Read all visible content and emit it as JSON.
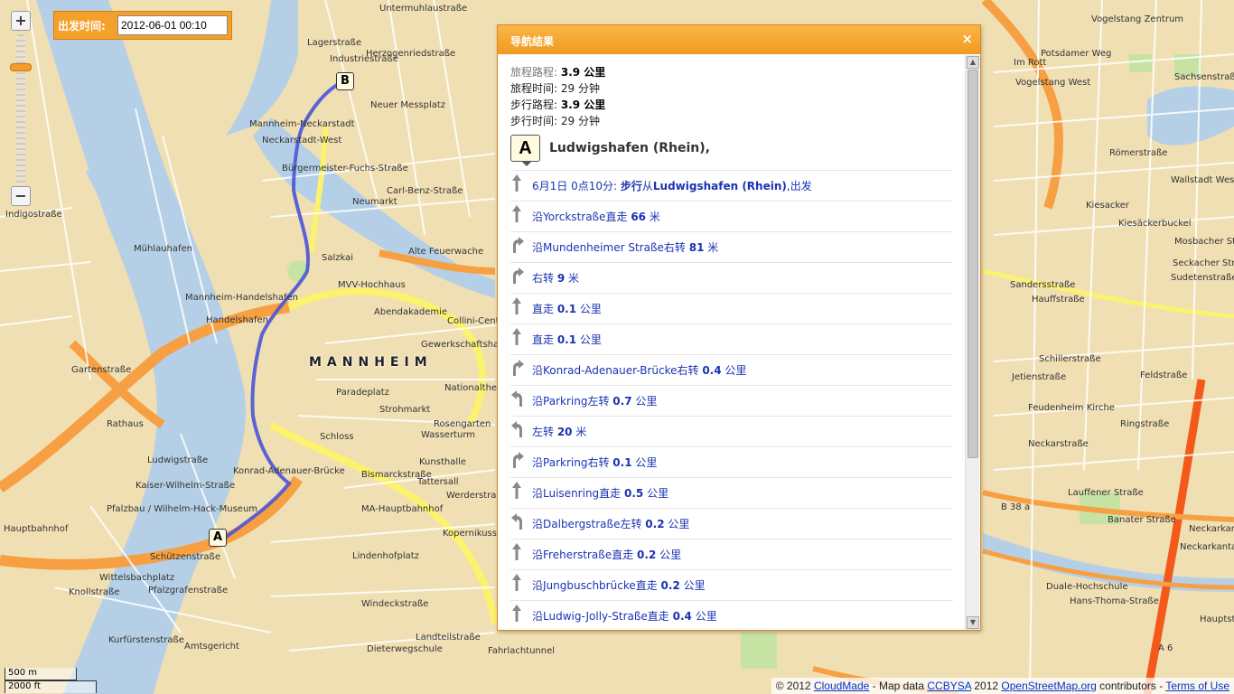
{
  "departure": {
    "label": "出发时间:",
    "value": "2012-06-01 00:10"
  },
  "zoom": {
    "in_label": "+",
    "out_label": "−"
  },
  "scale": {
    "metric": "500 m",
    "imperial": "2000 ft"
  },
  "attribution": {
    "prefix": "© 2012 ",
    "cloudmade": "CloudMade",
    "mapdata": " - Map data ",
    "ccbysa": "CCBYSA",
    "year": " 2012 ",
    "osm": "OpenStreetMap.org",
    "contrib": " contributors - ",
    "terms": "Terms of Use"
  },
  "map": {
    "city": "MANNHEIM",
    "markers": {
      "start": "A",
      "end": "B"
    },
    "labels": [
      "Untermuhlaustraße",
      "Lagerstraße",
      "Industriestraße",
      "Herzogenriedstraße",
      "Neuer Messplatz",
      "Mannheim-Neckarstadt",
      "Neckarstadt-West",
      "Bürgermeister-Fuchs-Straße",
      "Carl-Benz-Straße",
      "Neumarkt",
      "Alte Feuerwache",
      "Salzkai",
      "MVV-Hochhaus",
      "Abendakademie",
      "Collini-Center",
      "Gewerkschaftshaus",
      "Nationaltheater",
      "Paradeplatz",
      "Strohmarkt",
      "Rosengarten",
      "Wasserturm",
      "Schloss",
      "Kunsthalle",
      "Tattersall",
      "Werderstraße",
      "MA-Hauptbahnhof",
      "Kopernikusstraße",
      "Lindenhofplatz",
      "Windeckstraße",
      "Landteilstraße",
      "Dieterwegschule",
      "Fahrlachtunnel",
      "Konrad-Adenauer-Brücke",
      "Bismarckstraße",
      "Mannheim-Handelshafen",
      "Handelshafen",
      "Mühlauhafen",
      "Gartenstraße",
      "Rathaus",
      "Ludwigstraße",
      "Kaiser-Wilhelm-Straße",
      "Pfalzbau / Wilhelm-Hack-Museum",
      "Hauptbahnhof",
      "Schützenstraße",
      "Wittelsbachplatz",
      "Pfalzgrafenstraße",
      "Amtsgericht",
      "Kurfürstenstraße",
      "Knollstraße",
      "Indigostraße",
      "Vogelstang Zentrum",
      "Potsdamer Weg",
      "Im Rott",
      "Vogelstang West",
      "Sachsenstraße",
      "Römerstraße",
      "Wallstadt West",
      "Kiesacker",
      "Mosbacher Straße",
      "Seckacher Straße",
      "Sandersstraße",
      "Hauffstraße",
      "Schillerstraße",
      "Feldstraße",
      "Jetienstraße",
      "Feudenheim Kirche",
      "Ringstraße",
      "Neckarstraße",
      "Lauffener Straße",
      "Banater Straße",
      "Neckarkanal",
      "Neckarkanta",
      "Duale-Hochschule",
      "Hans-Thoma-Straße",
      "Hauptstraße",
      "B 38 a",
      "A 6",
      "Sudetenstraße",
      "Kiesäckerbuckel"
    ]
  },
  "panel": {
    "title": "导航结果",
    "close_label": "×",
    "summary": {
      "route_label": "旅程路程:",
      "route_value": "3.9 公里",
      "time_label": "旅程时间:",
      "time_value": "29 分钟",
      "walk_label": "步行路程:",
      "walk_value": "3.9 公里",
      "walktime_label": "步行时间:",
      "walktime_value": "29 分钟"
    },
    "origin": {
      "badge": "A",
      "name": "Ludwigshafen (Rhein),"
    },
    "steps": [
      {
        "icon": "straight",
        "pre": "6月1日 0点10分: ",
        "em": "步行",
        "mid": "从",
        "name": "Ludwigshafen (Rhein)",
        "post": ",出发"
      },
      {
        "icon": "straight",
        "pre": "沿",
        "name": "Yorckstraße",
        "mid": "直走 ",
        "em": "66",
        "post": " 米"
      },
      {
        "icon": "right",
        "pre": "沿",
        "name": "Mundenheimer Straße",
        "mid": "右转 ",
        "em": "81",
        "post": " 米"
      },
      {
        "icon": "right",
        "pre": "",
        "name": "",
        "mid": "右转 ",
        "em": "9",
        "post": " 米"
      },
      {
        "icon": "straight",
        "pre": "",
        "name": "",
        "mid": "直走 ",
        "em": "0.1",
        "post": " 公里"
      },
      {
        "icon": "straight",
        "pre": "",
        "name": "",
        "mid": "直走 ",
        "em": "0.1",
        "post": " 公里"
      },
      {
        "icon": "right",
        "pre": "沿",
        "name": "Konrad-Adenauer-Brücke",
        "mid": "右转 ",
        "em": "0.4",
        "post": " 公里"
      },
      {
        "icon": "left",
        "pre": "沿",
        "name": "Parkring",
        "mid": "左转 ",
        "em": "0.7",
        "post": " 公里"
      },
      {
        "icon": "left",
        "pre": "",
        "name": "",
        "mid": "左转 ",
        "em": "20",
        "post": " 米"
      },
      {
        "icon": "right",
        "pre": "沿",
        "name": "Parkring",
        "mid": "右转 ",
        "em": "0.1",
        "post": " 公里"
      },
      {
        "icon": "straight",
        "pre": "沿",
        "name": "Luisenring",
        "mid": "直走 ",
        "em": "0.5",
        "post": " 公里"
      },
      {
        "icon": "left",
        "pre": "沿",
        "name": "Dalbergstraße",
        "mid": "左转 ",
        "em": "0.2",
        "post": " 公里"
      },
      {
        "icon": "straight",
        "pre": "沿",
        "name": "Freherstraße",
        "mid": "直走 ",
        "em": "0.2",
        "post": " 公里"
      },
      {
        "icon": "straight",
        "pre": "沿",
        "name": "Jungbuschbrücke",
        "mid": "直走 ",
        "em": "0.2",
        "post": " 公里"
      },
      {
        "icon": "straight",
        "pre": "沿",
        "name": "Ludwig-Jolly-Straße",
        "mid": "直走 ",
        "em": "0.4",
        "post": " 公里"
      }
    ]
  },
  "colors": {
    "map_bg": "#f1dfb4",
    "water": "#b5d0e6",
    "park": "#c6e3a4",
    "motorway": "#f7a043",
    "major_road": "#fbf26e",
    "route": "#4a55d6",
    "panel_header": "#f29a20",
    "step_text": "#1a33b3"
  }
}
